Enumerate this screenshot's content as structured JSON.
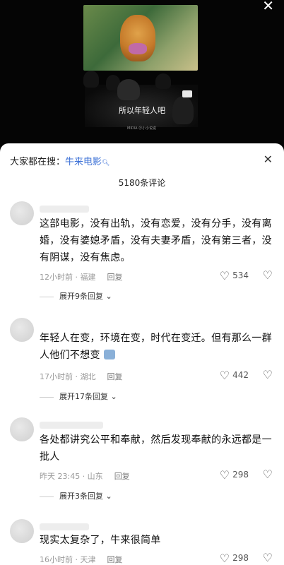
{
  "video": {
    "subtitle": "所以年轻人吧",
    "watermark": "MIDIA  ＠小小说说"
  },
  "sheet": {
    "search_prefix": "大家都在搜：",
    "search_keyword": "牛来电影",
    "comment_count": "5180条评论"
  },
  "comments": [
    {
      "text": "这部电影，没有出轨，没有恋爱，没有分手，没有离婚，没有婆媳矛盾，没有夫妻矛盾，没有第三者，没有阴谋，没有焦虑。",
      "time": "12小时前 · 福建",
      "reply": "回复",
      "likes": "534",
      "expand": "展开9条回复"
    },
    {
      "text": "年轻人在变，环境在变，时代在变迁。但有那么一群人他们不想变",
      "time": "17小时前 · 湖北",
      "reply": "回复",
      "likes": "442",
      "expand": "展开17条回复"
    },
    {
      "text": "各处都讲究公平和奉献，然后发现奉献的永远都是一批人",
      "time": "昨天 23:45 · 山东",
      "reply": "回复",
      "likes": "298",
      "expand": "展开3条回复"
    },
    {
      "text": "现实太复杂了，牛来很简单",
      "time": "16小时前 · 天津",
      "reply": "回复",
      "likes": "298"
    }
  ]
}
